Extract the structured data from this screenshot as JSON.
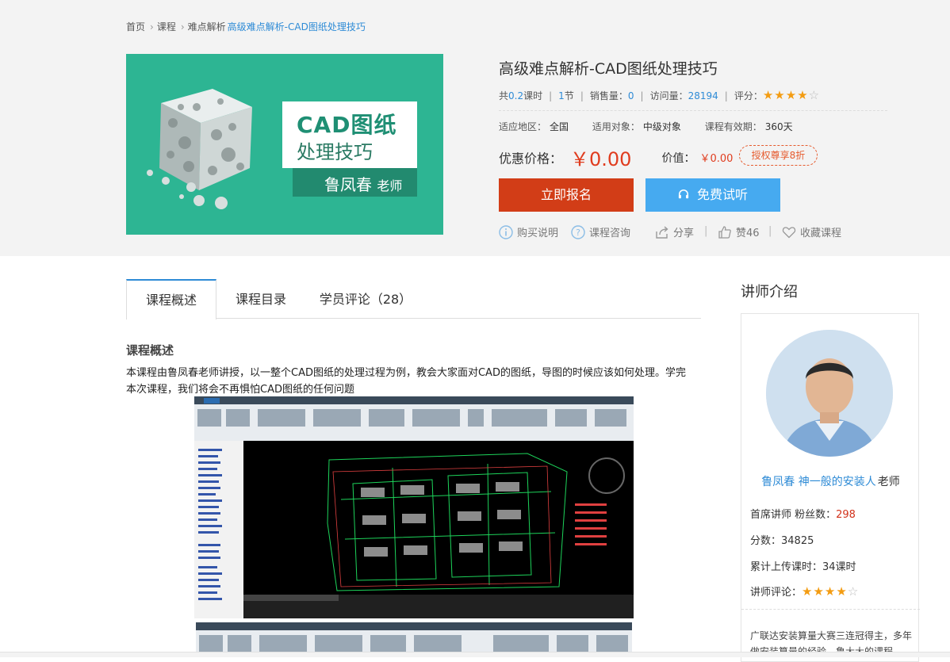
{
  "breadcrumb": [
    "首页",
    "课程",
    "难点解析",
    "高级难点解析-CAD图纸处理技巧"
  ],
  "cover": {
    "line1": "CAD图纸",
    "line2": "处理技巧",
    "teacher_name": "鲁凤春",
    "teacher_suffix": "老师"
  },
  "course": {
    "title": "高级难点解析-CAD图纸处理技巧",
    "meta": {
      "hours_prefix": "共",
      "hours_value": "0.2",
      "hours_suffix": "课时",
      "sections_value": "1",
      "sections_suffix": "节",
      "sales_label": "销售量：",
      "sales_value": "0",
      "views_label": "访问量：",
      "views_value": "28194",
      "rating_label": "评分：",
      "rating": 4,
      "rating_max": 5
    },
    "region_label": "适应地区：",
    "region_value": "全国",
    "target_label": "适用对象：",
    "target_value": "中级对象",
    "valid_label": "课程有效期：",
    "valid_value": "360天",
    "price_label": "优惠价格：",
    "price_value": "￥0.00",
    "value_label": "价值：",
    "value_value": "￥0.00",
    "badge": "授权尊享8折",
    "enroll_button": "立即报名",
    "trial_button": "免费试听",
    "actions": {
      "buy_help": "购买说明",
      "consult": "课程咨询",
      "share": "分享",
      "like": "赞46",
      "favorite": "收藏课程"
    }
  },
  "tabs": [
    "课程概述",
    "课程目录",
    "学员评论（28）"
  ],
  "overview": {
    "title": "课程概述",
    "text": " 本课程由鲁凤春老师讲授，以一整个CAD图纸的处理过程为例，教会大家面对CAD的图纸，导图的时候应该如何处理。学完本次课程，我们将会不再惧怕CAD图纸的任何问题"
  },
  "instructor": {
    "section_title": "讲师介绍",
    "name": "鲁凤春 神一般的安装人",
    "suffix": "老师",
    "fans_label": "首席讲师 粉丝数：",
    "fans_value": "298",
    "score_label": "分数：",
    "score_value": "34825",
    "hours_label": "累计上传课时：",
    "hours_value": "34课时",
    "review_label": "讲师评论：",
    "rating": 4,
    "rating_max": 5,
    "bio": "广联达安装算量大赛三连冠得主，多年做安装算量的经验，鲁大大的课程"
  },
  "colors": {
    "accent": "#2e8bd6",
    "enroll": "#d23d17",
    "trial": "#46aaf0",
    "price": "#e03c1e",
    "cover": "#2db593"
  },
  "icons": [
    "info-icon",
    "question-icon",
    "share-icon",
    "thumbs-up-icon",
    "heart-icon",
    "headphone-icon"
  ]
}
